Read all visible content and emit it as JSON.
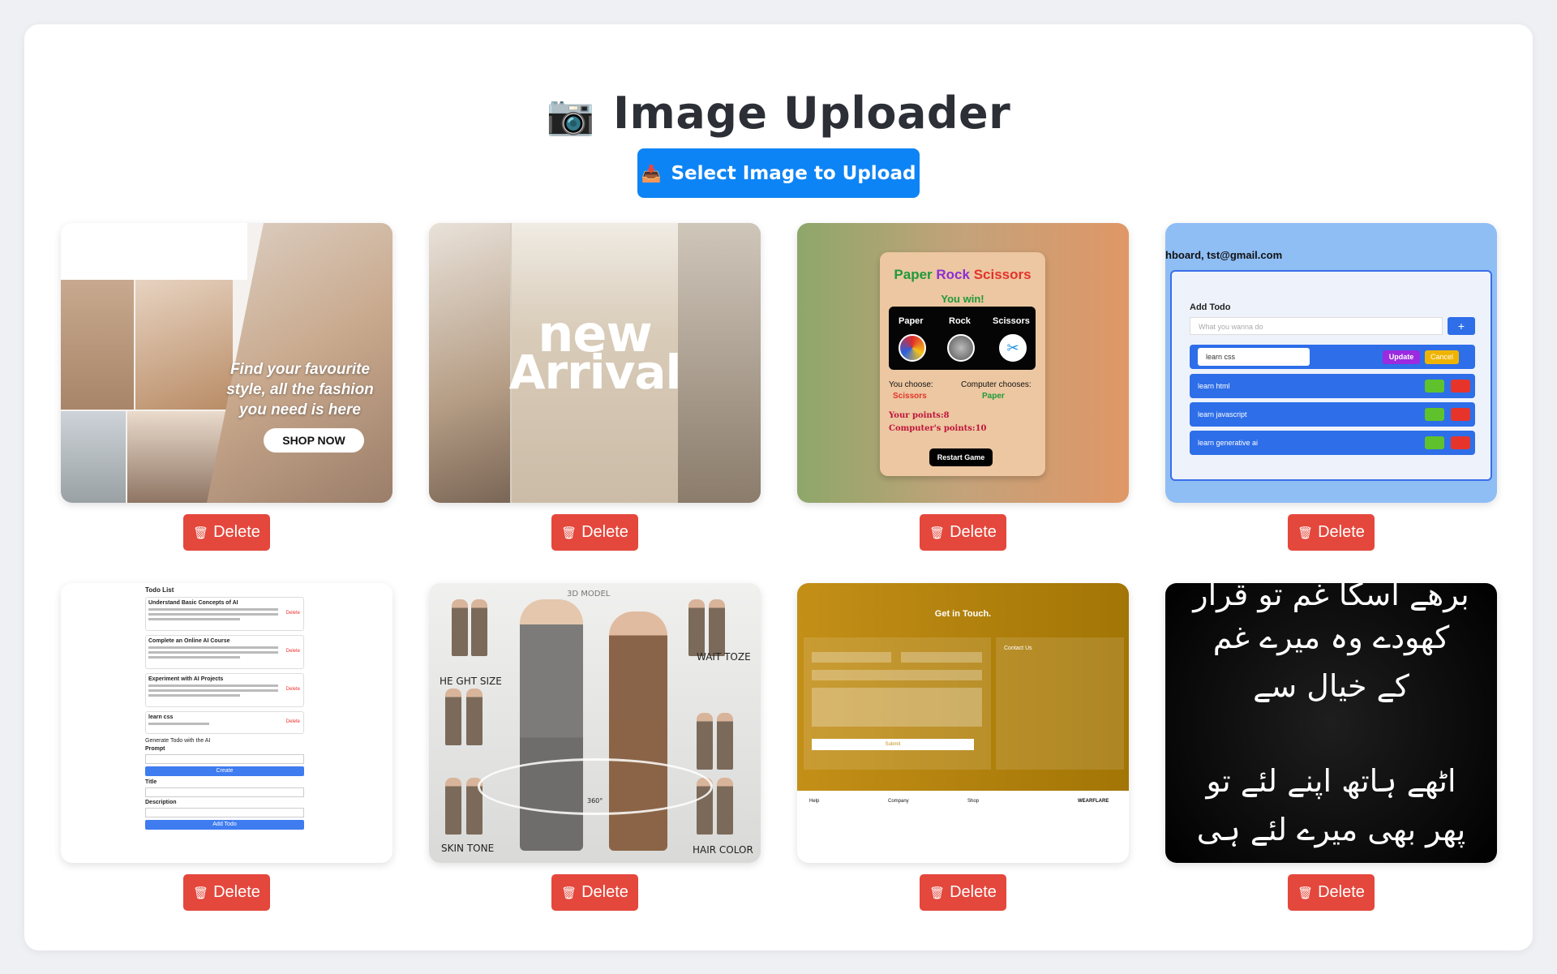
{
  "header": {
    "icon": "camera-icon",
    "title": "Image Uploader"
  },
  "upload": {
    "icon": "inbox-tray-icon",
    "label": "Select Image to Upload"
  },
  "accent_color": "#0d84f5",
  "delete_color": "#e4473c",
  "images": [
    {
      "delete_label": "Delete",
      "overlay": {
        "tagline": "Find your favourite style, all the fashion you need is here",
        "button": "SHOP NOW"
      }
    },
    {
      "delete_label": "Delete",
      "overlay": {
        "line1": "new",
        "line2": "Arrival"
      }
    },
    {
      "delete_label": "Delete",
      "overlay": {
        "title_paper": "Paper",
        "title_rock": "Rock",
        "title_scissors": "Scissors",
        "result": "You win!",
        "choices": [
          "Paper",
          "Rock",
          "Scissors"
        ],
        "you_choose": "You choose:",
        "you_value": "Scissors",
        "computer_chooses": "Computer chooses:",
        "computer_value": "Paper",
        "your_points": "Your points:8",
        "computer_points": "Computer's points:10",
        "restart": "Restart Game"
      }
    },
    {
      "delete_label": "Delete",
      "overlay": {
        "header": "hboard, tst@gmail.com",
        "add_todo": "Add Todo",
        "placeholder": "What you wanna do",
        "plus": "+",
        "editing_value": "learn css",
        "update": "Update",
        "cancel": "Cancel",
        "todos": [
          "learn html",
          "learn javascript",
          "learn generative ai"
        ]
      }
    },
    {
      "delete_label": "Delete",
      "overlay": {
        "header": "Todo List",
        "entries": [
          "Understand Basic Concepts of AI",
          "Complete an Online AI Course",
          "Experiment with AI Projects",
          "learn css"
        ],
        "entry_delete": "Delete",
        "generate": "Generate Todo with the AI",
        "prompt": "Prompt",
        "create": "Create",
        "title": "Title",
        "description": "Description",
        "add_todo": "Add Todo"
      }
    },
    {
      "delete_label": "Delete",
      "overlay": {
        "height": "HE GHT SIZE",
        "waist": "WAIT TOZE",
        "skin": "SKIN TONE",
        "hair": "HAIR COLOR",
        "model": "3D MODEL",
        "angle": "360°"
      }
    },
    {
      "delete_label": "Delete",
      "overlay": {
        "title": "Get in Touch.",
        "contact": "Contact Us",
        "submit": "Submit",
        "footer_cols": [
          "Help",
          "Company",
          "Shop"
        ],
        "brand": "WEARFLARE"
      }
    },
    {
      "delete_label": "Delete",
      "overlay": {
        "lines": [
          "برھے اسکا غم تو قرار",
          "کھودے وہ میرے غم",
          "کے خیال سے",
          "اٹھے ہاتھ اپنے لئے تو",
          "پھر بھی میرے لئے ہی"
        ]
      }
    }
  ]
}
